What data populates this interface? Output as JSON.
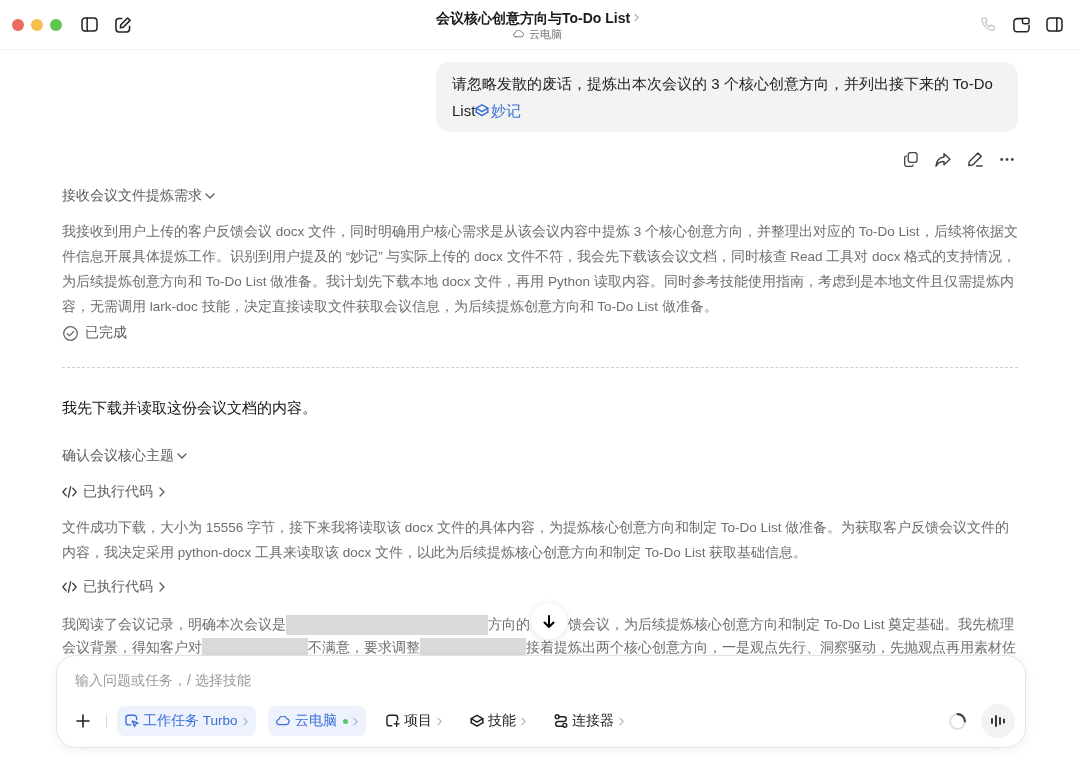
{
  "window": {
    "title": "会议核心创意方向与To-Do List",
    "subtitle": "云电脑"
  },
  "user_message": {
    "text": "请忽略发散的废话，提炼出本次会议的 3 个核心创意方向，并列出接下来的 To-Do List",
    "link": "妙记"
  },
  "blocks": [
    {
      "kind": "section",
      "title": "接收会议文件提炼需求",
      "expanded": true
    },
    {
      "kind": "paragraph",
      "text": "我接收到用户上传的客户反馈会议 docx 文件，同时明确用户核心需求是从该会议内容中提炼 3 个核心创意方向，并整理出对应的 To-Do List，后续将依据文件信息开展具体提炼工作。识别到用户提及的 “妙记” 与实际上传的 docx 文件不符，我会先下载该会议文档，同时核查 Read 工具对 docx 格式的支持情况，为后续提炼创意方向和 To-Do List 做准备。我计划先下载本地 docx 文件，再用 Python 读取内容。同时参考技能使用指南，考虑到是本地文件且仅需提炼内容，无需调用 lark-doc 技能，决定直接读取文件获取会议信息，为后续提炼创意方向和 To-Do List 做准备。"
    },
    {
      "kind": "status",
      "text": "已完成"
    },
    {
      "kind": "divider"
    },
    {
      "kind": "reply",
      "text": "我先下载并读取这份会议文档的内容。"
    },
    {
      "kind": "section",
      "title": "确认会议核心主题",
      "expanded": true
    },
    {
      "kind": "tool",
      "label": "已执行代码",
      "expanded": false
    },
    {
      "kind": "paragraph",
      "text": "文件成功下载，大小为 15556 字节，接下来我将读取该 docx 文件的具体内容，为提炼核心创意方向和制定 To-Do List 做准备。为获取客户反馈会议文件的内容，我决定采用 python-docx 工具来读取该 docx 文件，以此为后续提炼核心创意方向和制定 To-Do List 获取基础信息。"
    },
    {
      "kind": "tool",
      "label": "已执行代码",
      "expanded": false
    },
    {
      "kind": "redacted_paragraph",
      "lines": [
        [
          {
            "kind": "text",
            "text": "我阅读了会议记录，明确本次会议是"
          },
          {
            "kind": "redaction_long"
          },
          {
            "kind": "text",
            "text": "方向的"
          },
          {
            "kind": "scroll_button"
          },
          {
            "kind": "text",
            "text": "馈会议，为后续提炼核心创意方向和制定 To-Do List 奠定基础。我先梳理"
          }
        ],
        [
          {
            "kind": "text",
            "text": "会议背景，得知客户对"
          },
          {
            "kind": "redaction_short"
          },
          {
            "kind": "text",
            "text": "不满意，要求调整"
          },
          {
            "kind": "redaction_short"
          },
          {
            "kind": "text",
            "text": "接着提炼出两个核心创意方向，一是观点先行、洞察驱动，先抛观点再用素材佐"
          }
        ]
      ]
    }
  ],
  "composer": {
    "placeholder": "输入问题或任务，/ 选择技能",
    "tools": [
      {
        "kind": "task",
        "label": "工作任务 Turbo",
        "selected": true
      },
      {
        "kind": "cloud",
        "label": "云电脑",
        "selected": true,
        "color": "#5cc46a"
      },
      {
        "kind": "project",
        "label": "项目",
        "selected": false
      },
      {
        "kind": "skill",
        "label": "技能",
        "selected": false
      },
      {
        "kind": "connector",
        "label": "连接器",
        "selected": false
      }
    ]
  }
}
